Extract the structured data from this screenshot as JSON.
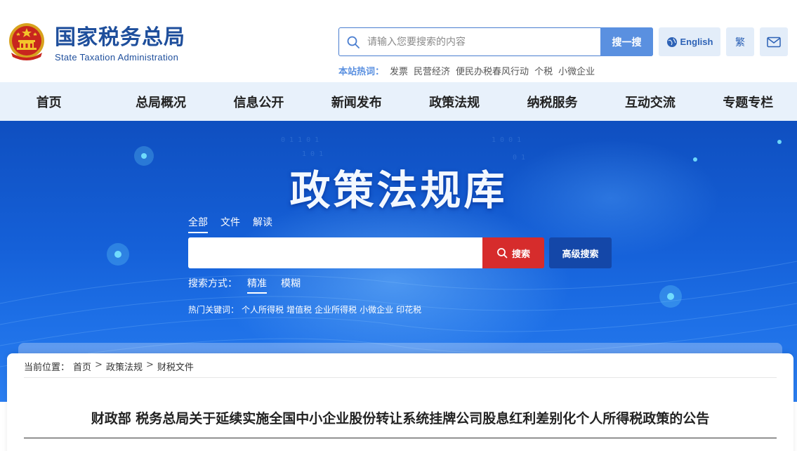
{
  "header": {
    "site_name_cn": "国家税务总局",
    "site_name_en": "State Taxation Administration",
    "search_placeholder": "请输入您要搜索的内容",
    "search_button": "搜一搜",
    "english_label": "English",
    "traditional_label": "繁",
    "hot_label": "本站热词：",
    "hot_words": [
      "发票",
      "民营经济",
      "便民办税春风行动",
      "个税",
      "小微企业"
    ]
  },
  "nav": {
    "items": [
      "首页",
      "总局概况",
      "信息公开",
      "新闻发布",
      "政策法规",
      "纳税服务",
      "互动交流",
      "专题专栏"
    ]
  },
  "banner": {
    "title": "政策法规库",
    "tabs": [
      "全部",
      "文件",
      "解读"
    ],
    "active_tab": 0,
    "search_button": "搜索",
    "advanced_button": "高级搜索",
    "mode_label": "搜索方式：",
    "modes": [
      "精准",
      "模糊"
    ],
    "active_mode": 0,
    "hot_label": "热门关键词：",
    "hot_keywords": [
      "个人所得税",
      "增值税",
      "企业所得税",
      "小微企业",
      "印花税"
    ]
  },
  "content": {
    "breadcrumb_label": "当前位置：",
    "breadcrumb": [
      "首页",
      "政策法规",
      "财税文件"
    ],
    "doc_title": "财政部 税务总局关于延续实施全国中小企业股份转让系统挂牌公司股息红利差别化个人所得税政策的公告"
  },
  "colors": {
    "brand_blue": "#1f4f9c",
    "accent_blue": "#5a90e0",
    "nav_bg": "#e8f1fb",
    "search_red": "#d62c2c",
    "advanced_blue": "#1447a8"
  },
  "icons": {
    "emblem": "national-emblem-icon",
    "search": "search-icon",
    "globe": "globe-icon",
    "mail": "mail-icon"
  }
}
